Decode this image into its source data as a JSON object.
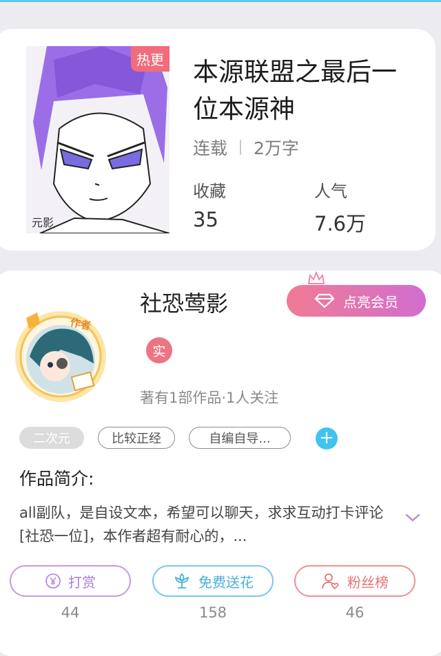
{
  "book": {
    "badge": "热更",
    "title": "本源联盟之最后一位本源神",
    "status": "连载",
    "word_count": "2万字",
    "stats": [
      {
        "label": "收藏",
        "value": "35"
      },
      {
        "label": "人气",
        "value": "7.6万"
      }
    ]
  },
  "author": {
    "name": "社恐莺影",
    "avatar_badge": "作者",
    "verified_badge": "实",
    "meta": "著有1部作品·1人关注",
    "vip_button": "点亮会员"
  },
  "tags": [
    "二次元",
    "比较正经",
    "自编自导..."
  ],
  "intro": {
    "heading": "作品简介:",
    "text": "all副队，是自设文本，希望可以聊天，求求互动打卡评论[社恐一位]，本作者超有耐心的，..."
  },
  "actions": [
    {
      "label": "打赏",
      "count": "44",
      "icon": "yen-coin-icon"
    },
    {
      "label": "免费送花",
      "count": "158",
      "icon": "flower-icon"
    },
    {
      "label": "粉丝榜",
      "count": "46",
      "icon": "user-heart-icon"
    }
  ],
  "colors": {
    "accent_pink": "#f16c7c",
    "vip_gradient": [
      "#f07b94",
      "#d26ecf"
    ],
    "add_blue": "#41c3ef",
    "reward_purple": "#c69be6",
    "flower_blue": "#76cae9",
    "fans_red": "#f09292"
  }
}
